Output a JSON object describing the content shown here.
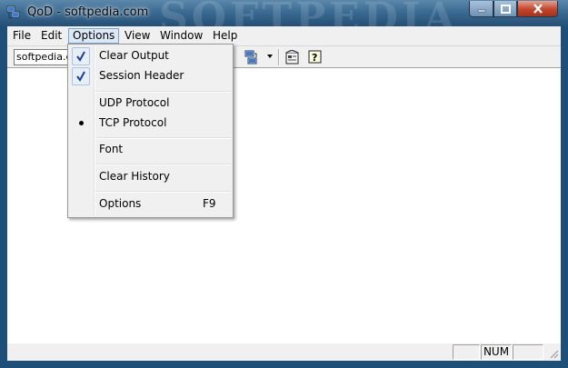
{
  "window": {
    "title": "QoD - softpedia.com",
    "watermark": "SOFTPEDIA"
  },
  "menubar": {
    "items": [
      "File",
      "Edit",
      "Options",
      "View",
      "Window",
      "Help"
    ],
    "active": "Options"
  },
  "toolbar": {
    "host_value": "softpedia.co",
    "icons": [
      "network-dropdown-icon",
      "properties-icon",
      "help-icon"
    ]
  },
  "options_menu": {
    "items": [
      {
        "label": "Clear Output",
        "state": "checked"
      },
      {
        "label": "Session Header",
        "state": "checked"
      },
      {
        "label": "UDP Protocol",
        "state": "none"
      },
      {
        "label": "TCP Protocol",
        "state": "radio"
      },
      {
        "label": "Font",
        "state": "none"
      },
      {
        "label": "Clear History",
        "state": "none"
      },
      {
        "label": "Options",
        "shortcut": "F9",
        "state": "none"
      }
    ]
  },
  "statusbar": {
    "panes": [
      "",
      "NUM",
      ""
    ]
  }
}
